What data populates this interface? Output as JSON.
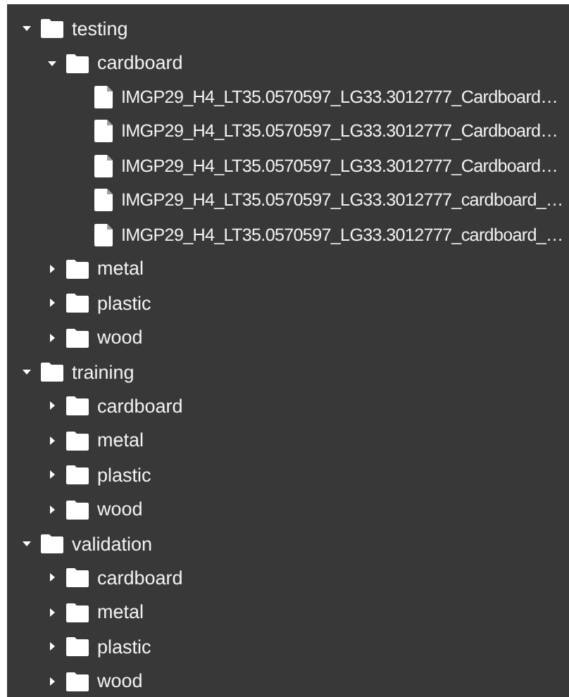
{
  "tree": [
    {
      "name": "testing",
      "kind": "folder",
      "expanded": true,
      "children": [
        {
          "name": "cardboard",
          "kind": "folder",
          "expanded": true,
          "children": [
            {
              "name": "IMGP29_H4_LT35.0570597_LG33.3012777_Cardboard…",
              "kind": "file"
            },
            {
              "name": "IMGP29_H4_LT35.0570597_LG33.3012777_Cardboard…",
              "kind": "file"
            },
            {
              "name": "IMGP29_H4_LT35.0570597_LG33.3012777_Cardboard…",
              "kind": "file"
            },
            {
              "name": "IMGP29_H4_LT35.0570597_LG33.3012777_cardboard_…",
              "kind": "file"
            },
            {
              "name": "IMGP29_H4_LT35.0570597_LG33.3012777_cardboard_…",
              "kind": "file"
            }
          ]
        },
        {
          "name": "metal",
          "kind": "folder",
          "expanded": false
        },
        {
          "name": "plastic",
          "kind": "folder",
          "expanded": false
        },
        {
          "name": "wood",
          "kind": "folder",
          "expanded": false
        }
      ]
    },
    {
      "name": "training",
      "kind": "folder",
      "expanded": true,
      "children": [
        {
          "name": "cardboard",
          "kind": "folder",
          "expanded": false
        },
        {
          "name": "metal",
          "kind": "folder",
          "expanded": false
        },
        {
          "name": "plastic",
          "kind": "folder",
          "expanded": false
        },
        {
          "name": "wood",
          "kind": "folder",
          "expanded": false
        }
      ]
    },
    {
      "name": "validation",
      "kind": "folder",
      "expanded": true,
      "children": [
        {
          "name": "cardboard",
          "kind": "folder",
          "expanded": false
        },
        {
          "name": "metal",
          "kind": "folder",
          "expanded": false
        },
        {
          "name": "plastic",
          "kind": "folder",
          "expanded": false
        },
        {
          "name": "wood",
          "kind": "folder",
          "expanded": false
        }
      ]
    }
  ]
}
